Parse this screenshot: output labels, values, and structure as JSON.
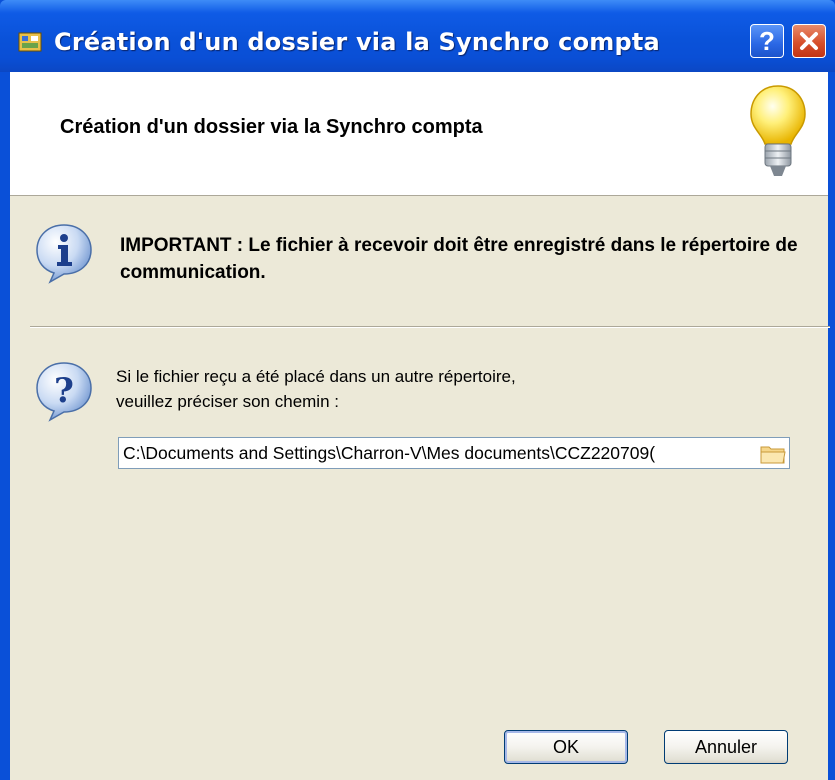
{
  "window": {
    "title": "Création d'un dossier via la Synchro compta",
    "help_label": "?",
    "close_label": "×"
  },
  "header": {
    "title": "Création d'un dossier via la Synchro compta",
    "icon": "lightbulb-icon"
  },
  "info": {
    "icon": "info-icon",
    "text": "IMPORTANT : Le fichier à recevoir doit être enregistré dans le répertoire de communication."
  },
  "question": {
    "icon": "question-icon",
    "text_line1": "Si le fichier reçu a été placé dans un autre répertoire,",
    "text_line2": "veuillez préciser son chemin :"
  },
  "path_field": {
    "value": "C:\\Documents and Settings\\Charron-V\\Mes documents\\CCZ220709("
  },
  "buttons": {
    "ok_label": "OK",
    "cancel_label": "Annuler"
  }
}
